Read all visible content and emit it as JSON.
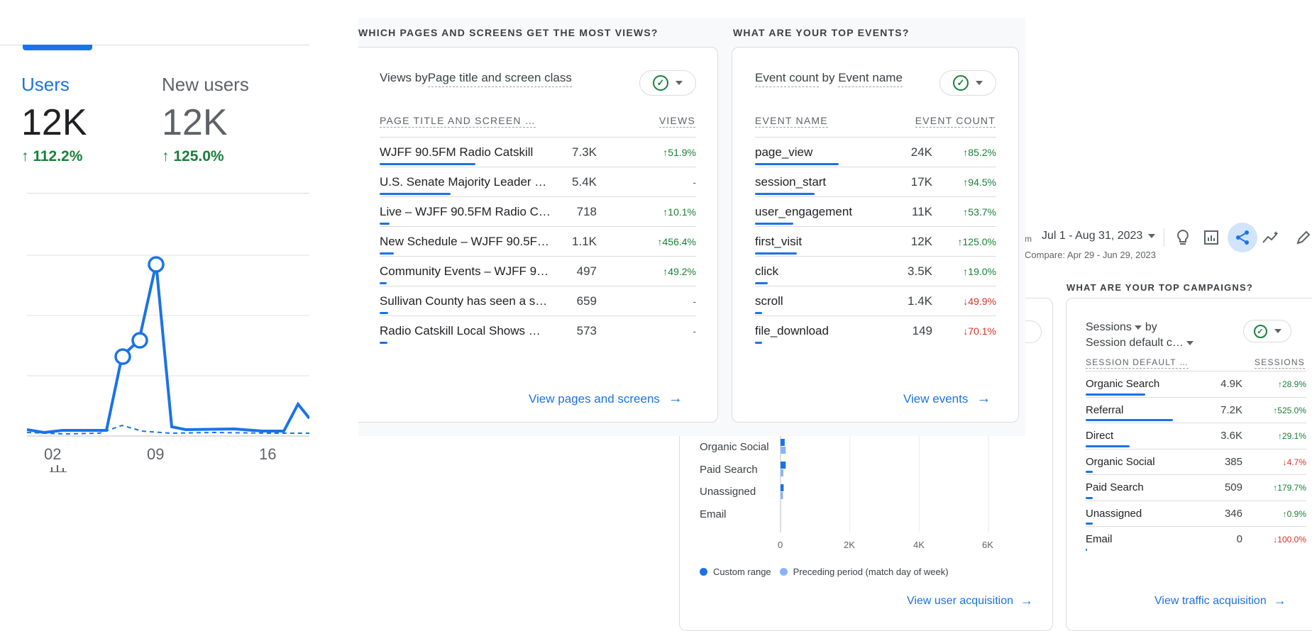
{
  "overview": {
    "metrics": [
      {
        "label": "Users",
        "value": "12K",
        "change": "112.2%",
        "dir": "up"
      },
      {
        "label": "New users",
        "value": "12K",
        "change": "125.0%",
        "dir": "up"
      }
    ],
    "x_ticks": [
      "02",
      "09",
      "16"
    ]
  },
  "pages_card": {
    "section_heading": "WHICH PAGES AND SCREENS GET THE MOST VIEWS?",
    "title_a": "Views by ",
    "title_b": "Page title and screen class",
    "col_name": "PAGE TITLE AND SCREEN …",
    "col_value": "VIEWS",
    "rows": [
      {
        "name": "WJFF 90.5FM Radio Catskill",
        "value": "7.3K",
        "change": "51.9%",
        "dir": "up",
        "share": 1.0
      },
      {
        "name": "U.S. Senate Majority Leader …",
        "value": "5.4K",
        "change": "-",
        "dir": "none",
        "share": 0.74
      },
      {
        "name": "Live – WJFF 90.5FM Radio C…",
        "value": "718",
        "change": "10.1%",
        "dir": "up",
        "share": 0.1
      },
      {
        "name": "New Schedule – WJFF 90.5F…",
        "value": "1.1K",
        "change": "456.4%",
        "dir": "up",
        "share": 0.15
      },
      {
        "name": "Community Events – WJFF 9…",
        "value": "497",
        "change": "49.2%",
        "dir": "up",
        "share": 0.07
      },
      {
        "name": "Sullivan County has seen a s…",
        "value": "659",
        "change": "-",
        "dir": "none",
        "share": 0.09
      },
      {
        "name": "Radio Catskill Local Shows …",
        "value": "573",
        "change": "-",
        "dir": "none",
        "share": 0.08
      }
    ],
    "link": "View pages and screens"
  },
  "events_card": {
    "section_heading": "WHAT ARE YOUR TOP EVENTS?",
    "title_a": "Event count",
    "title_b": " by ",
    "title_c": "Event name",
    "col_name": "EVENT NAME",
    "col_value": "EVENT COUNT",
    "rows": [
      {
        "name": "page_view",
        "value": "24K",
        "change": "85.2%",
        "dir": "up",
        "share": 1.0
      },
      {
        "name": "session_start",
        "value": "17K",
        "change": "94.5%",
        "dir": "up",
        "share": 0.71
      },
      {
        "name": "user_engagement",
        "value": "11K",
        "change": "53.7%",
        "dir": "up",
        "share": 0.46
      },
      {
        "name": "first_visit",
        "value": "12K",
        "change": "125.0%",
        "dir": "up",
        "share": 0.5
      },
      {
        "name": "click",
        "value": "3.5K",
        "change": "19.0%",
        "dir": "up",
        "share": 0.15
      },
      {
        "name": "scroll",
        "value": "1.4K",
        "change": "49.9%",
        "dir": "down",
        "share": 0.06
      },
      {
        "name": "file_download",
        "value": "149",
        "change": "70.1%",
        "dir": "down",
        "share": 0.01
      }
    ],
    "link": "View events"
  },
  "toolbar": {
    "date_prefix": "m",
    "date_range": "Jul 1 - Aug 31, 2023",
    "compare": "Compare: Apr 29 - Jun 29, 2023"
  },
  "acquisition_card": {
    "chart_data": {
      "type": "bar",
      "categories": [
        "Organic Social",
        "Paid Search",
        "Unassigned",
        "Email"
      ],
      "series": [
        {
          "name": "Custom range",
          "values": [
            120,
            150,
            90,
            0
          ]
        },
        {
          "name": "Preceding period (match day of week)",
          "values": [
            150,
            80,
            70,
            0
          ]
        }
      ],
      "x_ticks": [
        "0",
        "2K",
        "4K",
        "6K"
      ],
      "xlim": [
        0,
        6000
      ]
    },
    "legend": [
      "Custom range",
      "Preceding period (match day of week)"
    ],
    "link": "View user acquisition"
  },
  "campaigns_card": {
    "section_heading": "WHAT ARE YOUR TOP CAMPAIGNS?",
    "title_a": "Sessions",
    "title_b": " by",
    "title_c": "Session default c…",
    "col_name": "SESSION DEFAULT …",
    "col_value": "SESSIONS",
    "rows": [
      {
        "name": "Organic Search",
        "value": "4.9K",
        "change": "28.9%",
        "dir": "up",
        "share": 0.68
      },
      {
        "name": "Referral",
        "value": "7.2K",
        "change": "525.0%",
        "dir": "up",
        "share": 1.0
      },
      {
        "name": "Direct",
        "value": "3.6K",
        "change": "29.1%",
        "dir": "up",
        "share": 0.5
      },
      {
        "name": "Organic Social",
        "value": "385",
        "change": "4.7%",
        "dir": "down",
        "share": 0.05
      },
      {
        "name": "Paid Search",
        "value": "509",
        "change": "179.7%",
        "dir": "up",
        "share": 0.07
      },
      {
        "name": "Unassigned",
        "value": "346",
        "change": "0.9%",
        "dir": "up",
        "share": 0.05
      },
      {
        "name": "Email",
        "value": "0",
        "change": "100.0%",
        "dir": "down",
        "share": 0.0
      }
    ],
    "link": "View traffic acquisition"
  },
  "colors": {
    "accent": "#1a73e8",
    "accent_light": "#8ab4f8",
    "up": "#188038",
    "down": "#d93025"
  }
}
